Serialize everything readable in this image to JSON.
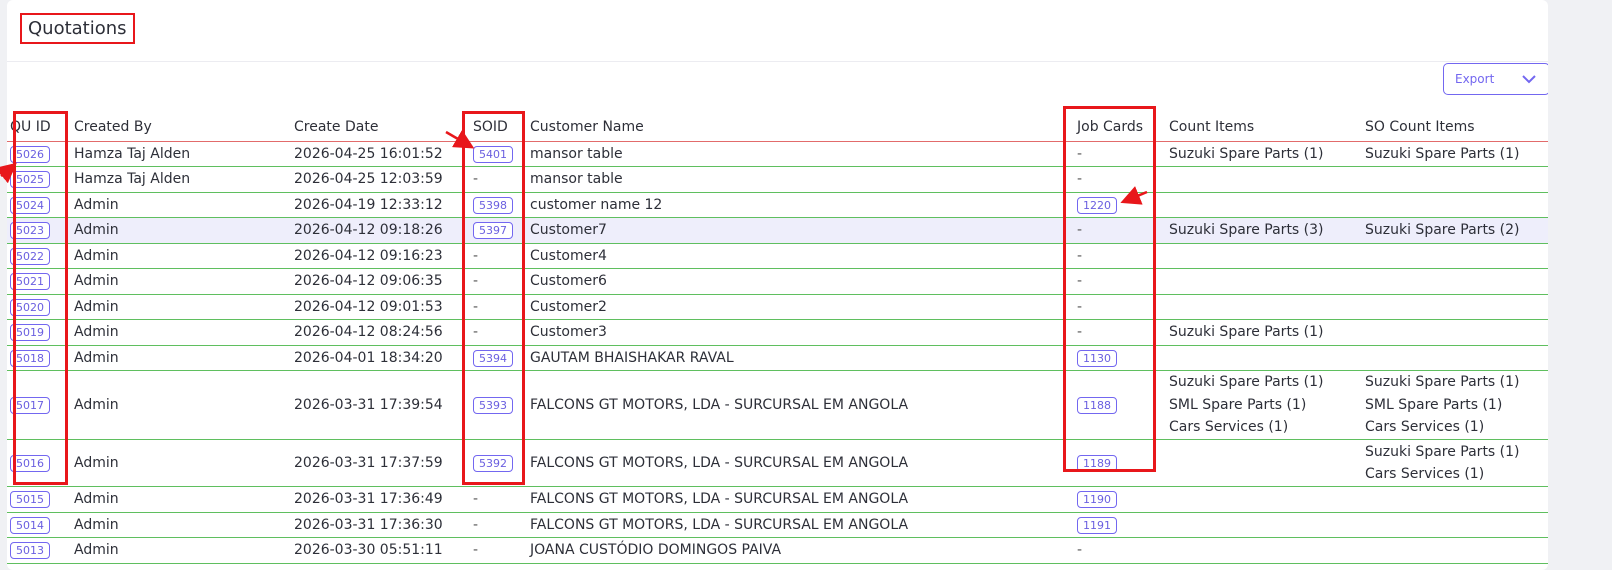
{
  "header": {
    "title": "Quotations"
  },
  "toolbar": {
    "export_label": "Export"
  },
  "columns": [
    "QU ID",
    "Created By",
    "Create Date",
    "SOID",
    "Customer Name",
    "Job Cards",
    "Count Items",
    "SO Count Items"
  ],
  "rows": [
    {
      "quid": "5026",
      "created_by": "Hamza Taj Alden",
      "date": "2026-04-25 16:01:52",
      "soid": "5401",
      "customer": "mansor table",
      "job": "",
      "count": [
        "Suzuki Spare Parts (1)"
      ],
      "so_count": [
        "Suzuki Spare Parts (1)"
      ]
    },
    {
      "quid": "5025",
      "created_by": "Hamza Taj Alden",
      "date": "2026-04-25 12:03:59",
      "soid": "",
      "customer": "mansor table",
      "job": "",
      "count": [],
      "so_count": []
    },
    {
      "quid": "5024",
      "created_by": "Admin",
      "date": "2026-04-19 12:33:12",
      "soid": "5398",
      "customer": "customer name 12",
      "job": "1220",
      "count": [],
      "so_count": []
    },
    {
      "quid": "5023",
      "created_by": "Admin",
      "date": "2026-04-12 09:18:26",
      "soid": "5397",
      "customer": "Customer7",
      "job": "",
      "count": [
        "Suzuki Spare Parts (3)"
      ],
      "so_count": [
        "Suzuki Spare Parts (2)"
      ]
    },
    {
      "quid": "5022",
      "created_by": "Admin",
      "date": "2026-04-12 09:16:23",
      "soid": "",
      "customer": "Customer4",
      "job": "",
      "count": [],
      "so_count": []
    },
    {
      "quid": "5021",
      "created_by": "Admin",
      "date": "2026-04-12 09:06:35",
      "soid": "",
      "customer": "Customer6",
      "job": "",
      "count": [],
      "so_count": []
    },
    {
      "quid": "5020",
      "created_by": "Admin",
      "date": "2026-04-12 09:01:53",
      "soid": "",
      "customer": "Customer2",
      "job": "",
      "count": [],
      "so_count": []
    },
    {
      "quid": "5019",
      "created_by": "Admin",
      "date": "2026-04-12 08:24:56",
      "soid": "",
      "customer": "Customer3",
      "job": "",
      "count": [
        "Suzuki Spare Parts (1)"
      ],
      "so_count": []
    },
    {
      "quid": "5018",
      "created_by": "Admin",
      "date": "2026-04-01 18:34:20",
      "soid": "5394",
      "customer": "GAUTAM BHAISHAKAR RAVAL",
      "job": "1130",
      "count": [],
      "so_count": []
    },
    {
      "quid": "5017",
      "created_by": "Admin",
      "date": "2026-03-31 17:39:54",
      "soid": "5393",
      "customer": "FALCONS GT MOTORS, LDA - SURCURSAL EM ANGOLA",
      "job": "1188",
      "count": [
        "Suzuki Spare Parts (1)",
        "SML Spare Parts (1)",
        "Cars Services (1)"
      ],
      "so_count": [
        "Suzuki Spare Parts (1)",
        "SML Spare Parts (1)",
        "Cars Services (1)"
      ]
    },
    {
      "quid": "5016",
      "created_by": "Admin",
      "date": "2026-03-31 17:37:59",
      "soid": "5392",
      "customer": "FALCONS GT MOTORS, LDA - SURCURSAL EM ANGOLA",
      "job": "1189",
      "count": [],
      "so_count": [
        "Suzuki Spare Parts (1)",
        "Cars Services (1)"
      ]
    },
    {
      "quid": "5015",
      "created_by": "Admin",
      "date": "2026-03-31 17:36:49",
      "soid": "",
      "customer": "FALCONS GT MOTORS, LDA - SURCURSAL EM ANGOLA",
      "job": "1190",
      "count": [],
      "so_count": []
    },
    {
      "quid": "5014",
      "created_by": "Admin",
      "date": "2026-03-31 17:36:30",
      "soid": "",
      "customer": "FALCONS GT MOTORS, LDA - SURCURSAL EM ANGOLA",
      "job": "1191",
      "count": [],
      "so_count": []
    },
    {
      "quid": "5013",
      "created_by": "Admin",
      "date": "2026-03-30 05:51:11",
      "soid": "",
      "customer": "JOANA CUSTÓDIO DOMINGOS PAIVA",
      "job": "",
      "count": [],
      "so_count": []
    }
  ],
  "empty_value": "-",
  "highlight_row": 3,
  "colors": {
    "accent": "#7367f0",
    "annotation": "#e8171b",
    "row_border": "#5fbf5f",
    "header_border": "#e26b6b",
    "highlight": "#eeeefb"
  }
}
